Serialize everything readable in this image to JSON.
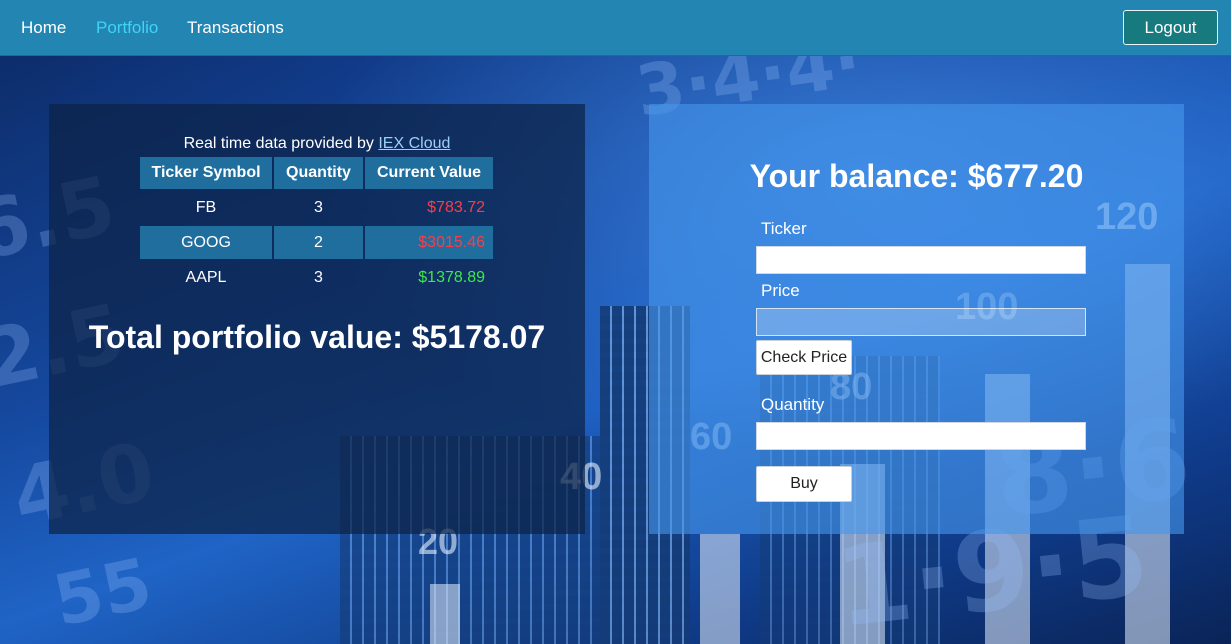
{
  "nav": {
    "items": [
      {
        "label": "Home",
        "active": false
      },
      {
        "label": "Portfolio",
        "active": true
      },
      {
        "label": "Transactions",
        "active": false
      }
    ],
    "logout_label": "Logout"
  },
  "portfolio": {
    "attribution_prefix": "Real time data provided by",
    "attribution_link": "IEX Cloud",
    "columns": [
      "Ticker Symbol",
      "Quantity",
      "Current Value"
    ],
    "rows": [
      {
        "ticker": "FB",
        "quantity": "3",
        "value": "$783.72",
        "trend": "down"
      },
      {
        "ticker": "GOOG",
        "quantity": "2",
        "value": "$3015.46",
        "trend": "down"
      },
      {
        "ticker": "AAPL",
        "quantity": "3",
        "value": "$1378.89",
        "trend": "up"
      }
    ],
    "total_label": "Total portfolio value: $5178.07"
  },
  "trade": {
    "balance_label": "Your balance: $677.20",
    "ticker_label": "Ticker",
    "ticker_value": "",
    "price_label": "Price",
    "price_value": "",
    "check_price_label": "Check Price",
    "quantity_label": "Quantity",
    "quantity_value": "",
    "buy_label": "Buy"
  },
  "colors": {
    "nav_bg": "#2385b1",
    "active_link": "#3fd4f5",
    "loss": "#ff3b47",
    "gain": "#3ee84a",
    "logout_bg": "#167a7e"
  },
  "background": {
    "numbers": [
      "120",
      "100",
      "80",
      "60",
      "40",
      "20"
    ]
  }
}
